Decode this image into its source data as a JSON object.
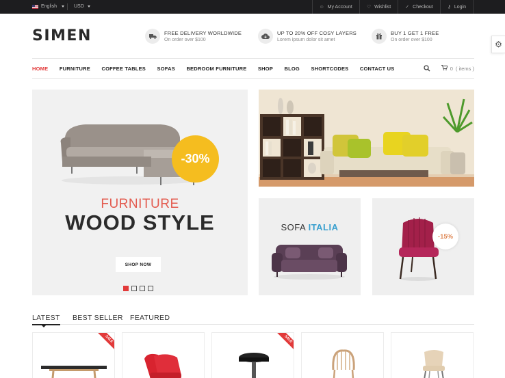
{
  "topbar": {
    "language": "English",
    "currency": "USD",
    "links": [
      {
        "label": "My Account",
        "icon": "user-icon",
        "glyph": "☺"
      },
      {
        "label": "Wishlist",
        "icon": "heart-icon",
        "glyph": "♡"
      },
      {
        "label": "Checkout",
        "icon": "checkmark-icon",
        "glyph": "✓"
      },
      {
        "label": "Login",
        "icon": "key-icon",
        "glyph": "⚷"
      }
    ]
  },
  "header": {
    "logo": "SIMEN",
    "features": [
      {
        "title": "FREE DELIVERY WORLDWIDE",
        "subtitle": "On order over $100",
        "icon": "truck-icon"
      },
      {
        "title": "UP TO 20% OFF COSY LAYERS",
        "subtitle": "Lorem ipsum dolor sit amet",
        "icon": "cloud-download-icon"
      },
      {
        "title": "BUY 1 GET 1 FREE",
        "subtitle": "On order over $100",
        "icon": "gift-icon"
      }
    ]
  },
  "nav": {
    "items": [
      "HOME",
      "FURNITURE",
      "COFFEE TABLES",
      "SOFAS",
      "BEDROOM FURNITURE",
      "SHOP",
      "BLOG",
      "SHORTCODES",
      "CONTACT US"
    ],
    "active_index": 0,
    "cart_count": "0",
    "cart_label": "( items )"
  },
  "hero": {
    "badge": "-30%",
    "subtitle": "FURNITURE",
    "title": "WOOD STYLE",
    "button": "SHOP NOW",
    "slides": 4,
    "active_slide": 0
  },
  "banners": {
    "sofa": {
      "title_part1": "SOFA",
      "title_part2": "ITALIA"
    },
    "chair": {
      "badge": "-15%"
    }
  },
  "product_tabs": {
    "tabs": [
      "LATEST",
      "BEST SELLER",
      "FEATURED"
    ],
    "active_index": 0
  },
  "products": [
    {
      "name": "coffee-table",
      "ribbon": "SALE"
    },
    {
      "name": "red-chair",
      "ribbon": ""
    },
    {
      "name": "black-stool",
      "ribbon": "SALE"
    },
    {
      "name": "wooden-chair",
      "ribbon": ""
    },
    {
      "name": "beige-chair",
      "ribbon": ""
    }
  ],
  "colors": {
    "accent": "#e23a3a",
    "badge_yellow": "#f5bd1f",
    "italia_blue": "#3aa0cf",
    "topbar_bg": "#1d1d1f"
  }
}
